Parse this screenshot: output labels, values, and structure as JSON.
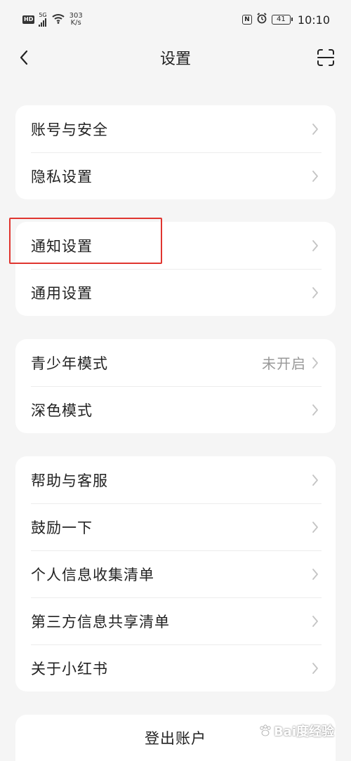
{
  "status_bar": {
    "hd": "HD",
    "network": "5G",
    "speed_value": "303",
    "speed_unit": "K/s",
    "nfc": "N",
    "battery": "41",
    "time": "10:10"
  },
  "nav": {
    "title": "设置"
  },
  "groups": [
    {
      "items": [
        {
          "label": "账号与安全",
          "value": ""
        },
        {
          "label": "隐私设置",
          "value": ""
        }
      ]
    },
    {
      "items": [
        {
          "label": "通知设置",
          "value": ""
        },
        {
          "label": "通用设置",
          "value": ""
        }
      ]
    },
    {
      "items": [
        {
          "label": "青少年模式",
          "value": "未开启"
        },
        {
          "label": "深色模式",
          "value": ""
        }
      ]
    },
    {
      "items": [
        {
          "label": "帮助与客服",
          "value": ""
        },
        {
          "label": "鼓励一下",
          "value": ""
        },
        {
          "label": "个人信息收集清单",
          "value": ""
        },
        {
          "label": "第三方信息共享清单",
          "value": ""
        },
        {
          "label": "关于小红书",
          "value": ""
        }
      ]
    }
  ],
  "logout": {
    "label": "登出账户"
  },
  "watermark": {
    "text": "Bai度经验"
  },
  "colors": {
    "background": "#f5f5f5",
    "card": "#ffffff",
    "highlight": "#e0352f",
    "chevron": "#c4c4c4"
  }
}
